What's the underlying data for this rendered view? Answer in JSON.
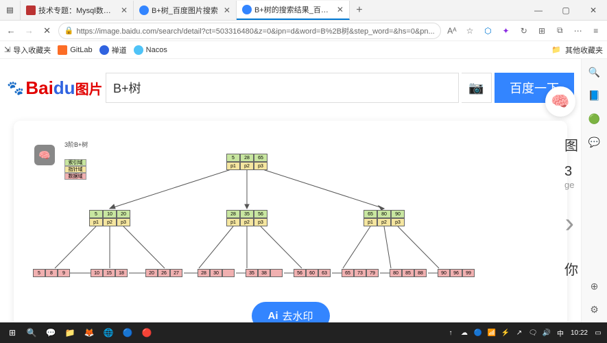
{
  "tabs": [
    {
      "title": "技术专题：Mysql数据库（视图…",
      "icon": "#bb3333"
    },
    {
      "title": "B+树_百度图片搜索",
      "icon": "#3385ff"
    },
    {
      "title": "B+树的搜索结果_百度图片搜索",
      "icon": "#3385ff",
      "active": true
    }
  ],
  "window": {
    "min": "—",
    "max": "▢",
    "close": "✕",
    "newtab": "+"
  },
  "nav": {
    "back": "←",
    "forward": "→",
    "stop": "✕",
    "lock": "🔒"
  },
  "url": "https://image.baidu.com/search/detail?ct=503316480&z=0&ipn=d&word=B%2B树&step_word=&hs=0&pn...",
  "addr_icons": {
    "text": "Aᴬ",
    "star": "☆",
    "shield": "⬡",
    "ext": "✦",
    "refresh": "↻",
    "collect": "⊞",
    "more": "≡",
    "puzzle": "⧉",
    "dots": "⋯"
  },
  "bookmarks": {
    "import": "导入收藏夹",
    "items": [
      {
        "label": "GitLab",
        "color": "#fc6d26"
      },
      {
        "label": "禅道",
        "color": "#3063e0"
      },
      {
        "label": "Nacos",
        "color": "#4fc3f7"
      }
    ],
    "other": "其他收藏夹"
  },
  "search": {
    "query": "B+树",
    "button": "百度一下",
    "camera": "📷",
    "logo_prefix": "Bai",
    "logo_du": "du",
    "logo_suffix": "图片"
  },
  "brain_emoji": "🧠",
  "side_panel": {
    "l1": "图",
    "l2": "3",
    "l3": "ge",
    "l4": "你"
  },
  "next_arrow": "›",
  "diagram": {
    "title": "3阶B+树",
    "legend": [
      "索引域",
      "指针域",
      "数据域"
    ],
    "root": {
      "keys": [
        "5",
        "28",
        "65"
      ],
      "ptrs": [
        "p1",
        "p2",
        "p3"
      ]
    },
    "inner": [
      {
        "keys": [
          "5",
          "10",
          "20"
        ],
        "ptrs": [
          "p1",
          "p2",
          "p3"
        ]
      },
      {
        "keys": [
          "28",
          "35",
          "56"
        ],
        "ptrs": [
          "p1",
          "p2",
          "p3"
        ]
      },
      {
        "keys": [
          "65",
          "80",
          "90"
        ],
        "ptrs": [
          "p1",
          "p2",
          "p3"
        ]
      }
    ],
    "leaves": [
      [
        "5",
        "8",
        "9"
      ],
      [
        "10",
        "15",
        "18"
      ],
      [
        "20",
        "26",
        "27"
      ],
      [
        "28",
        "30",
        ""
      ],
      [
        "35",
        "38",
        ""
      ],
      [
        "56",
        "60",
        "63"
      ],
      [
        "65",
        "73",
        "79"
      ],
      [
        "80",
        "85",
        "88"
      ],
      [
        "90",
        "96",
        "99"
      ]
    ]
  },
  "watermark": {
    "prefix": "Ai",
    "label": "去水印"
  },
  "taskbar": {
    "left_icons": [
      "⊞",
      "🔍",
      "💬",
      "📁",
      "🦊",
      "🌐",
      "🔵",
      "🔴"
    ],
    "right_icons": [
      "↑",
      "☁",
      "🔵",
      "📶",
      "⚡",
      "↗",
      "🗨",
      "🔊",
      "中"
    ],
    "time": "10:22",
    "date": "▭"
  },
  "sidebar_icons": [
    "🔍",
    "📘",
    "🟢",
    "💬",
    "⊕",
    "⚙"
  ]
}
